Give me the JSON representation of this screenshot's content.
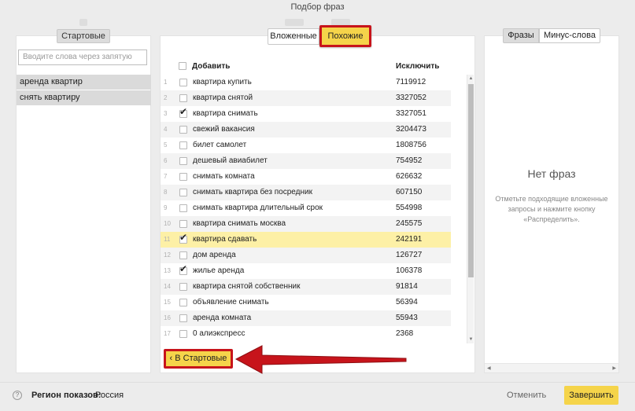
{
  "window": {
    "title": "Подбор фраз"
  },
  "left_panel": {
    "tab_label": "Стартовые",
    "input_placeholder": "Вводите слова через запятую",
    "items": [
      "аренда квартир",
      "снять квартиру"
    ]
  },
  "middle_panel": {
    "tabs": {
      "nested": "Вложенные",
      "similar": "Похожие"
    },
    "headers": {
      "add": "Добавить",
      "exclude": "Исключить"
    },
    "rows": [
      {
        "num": "1",
        "phrase": "квартира купить",
        "count": "7119912",
        "checked": false
      },
      {
        "num": "2",
        "phrase": "квартира снятой",
        "count": "3327052",
        "checked": false
      },
      {
        "num": "3",
        "phrase": "квартира снимать",
        "count": "3327051",
        "checked": true
      },
      {
        "num": "4",
        "phrase": "свежий вакансия",
        "count": "3204473",
        "checked": false
      },
      {
        "num": "5",
        "phrase": "билет самолет",
        "count": "1808756",
        "checked": false
      },
      {
        "num": "6",
        "phrase": "дешевый авиабилет",
        "count": "754952",
        "checked": false
      },
      {
        "num": "7",
        "phrase": "снимать комната",
        "count": "626632",
        "checked": false
      },
      {
        "num": "8",
        "phrase": "снимать квартира без посредник",
        "count": "607150",
        "checked": false
      },
      {
        "num": "9",
        "phrase": "снимать квартира длительный срок",
        "count": "554998",
        "checked": false
      },
      {
        "num": "10",
        "phrase": "квартира снимать москва",
        "count": "245575",
        "checked": false
      },
      {
        "num": "11",
        "phrase": "квартира сдавать",
        "count": "242191",
        "checked": true
      },
      {
        "num": "12",
        "phrase": "дом аренда",
        "count": "126727",
        "checked": false
      },
      {
        "num": "13",
        "phrase": "жилье аренда",
        "count": "106378",
        "checked": true
      },
      {
        "num": "14",
        "phrase": "квартира снятой собственник",
        "count": "91814",
        "checked": false
      },
      {
        "num": "15",
        "phrase": "объявление снимать",
        "count": "56394",
        "checked": false
      },
      {
        "num": "16",
        "phrase": "аренда комната",
        "count": "55943",
        "checked": false
      },
      {
        "num": "17",
        "phrase": "0 алиэкспресс",
        "count": "2368",
        "checked": false
      }
    ],
    "back_button": "В Стартовые"
  },
  "right_panel": {
    "tabs": {
      "phrases": "Фразы",
      "minus": "Минус-слова"
    },
    "empty_title": "Нет фраз",
    "empty_desc": "Отметьте подходящие вложенные запросы и нажмите кнопку «Распределить»."
  },
  "footer": {
    "region_label": "Регион показов:",
    "region_value": "Россия",
    "cancel": "Отменить",
    "finish": "Завершить"
  },
  "colors": {
    "accent": "#f5d44a",
    "highlight_border": "#c7141b",
    "row_highlight": "#fdf0a6"
  }
}
